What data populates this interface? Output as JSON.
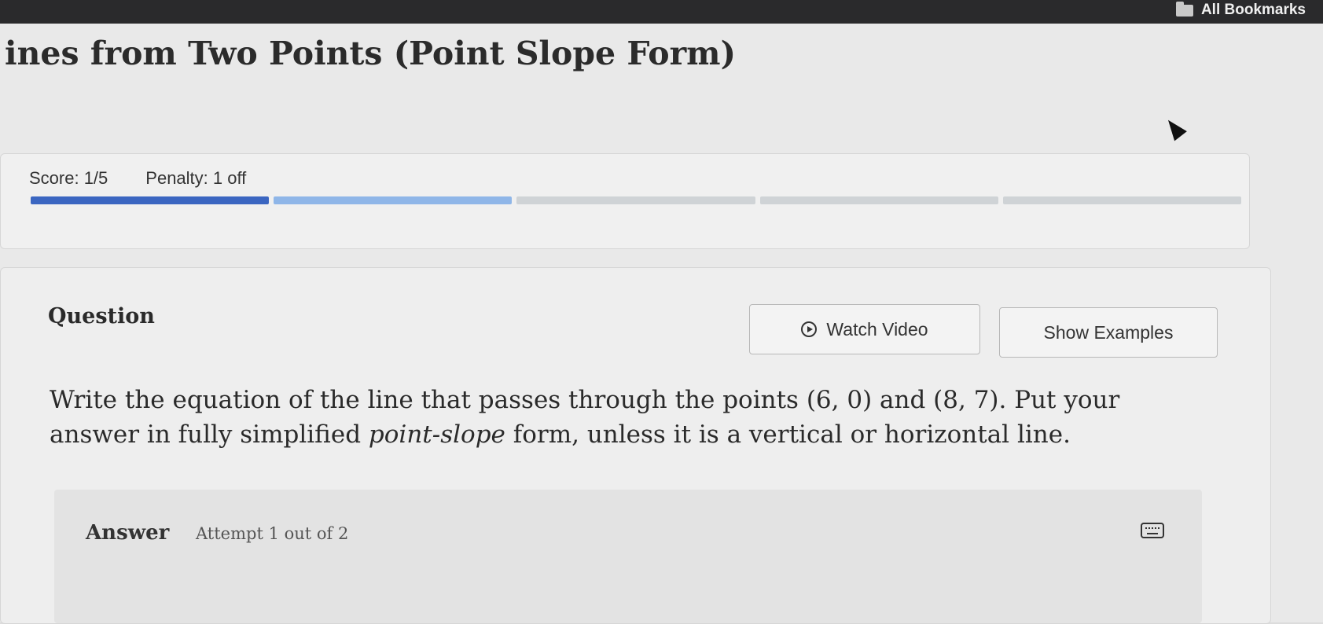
{
  "browser": {
    "bookmarks_label": "All Bookmarks",
    "icon": "folder-icon"
  },
  "page": {
    "title": "ines from Two Points (Point Slope Form)"
  },
  "score": {
    "score_text": "Score: 1/5",
    "penalty_text": "Penalty: 1 off"
  },
  "progress": {
    "segments": [
      "filled",
      "partial",
      "empty",
      "empty",
      "empty"
    ],
    "completed": 1,
    "total": 5
  },
  "question": {
    "heading": "Question",
    "watch_video_label": "Watch Video",
    "show_examples_label": "Show Examples",
    "text_part1": "Write the equation of the line that passes through the points ",
    "point1": "(6, 0)",
    "text_and": " and ",
    "point2": "(8, 7)",
    "text_part2": ". Put your answer in fully simplified ",
    "emphasis": "point-slope",
    "text_part3": " form, unless it is a vertical or horizontal line."
  },
  "answer": {
    "label": "Answer",
    "attempt_text": "Attempt 1 out of 2",
    "icon": "keyboard-icon"
  },
  "colors": {
    "progress_filled": "#3b66c1",
    "progress_partial": "#8fb6e8",
    "progress_empty": "#cfd3d6"
  }
}
